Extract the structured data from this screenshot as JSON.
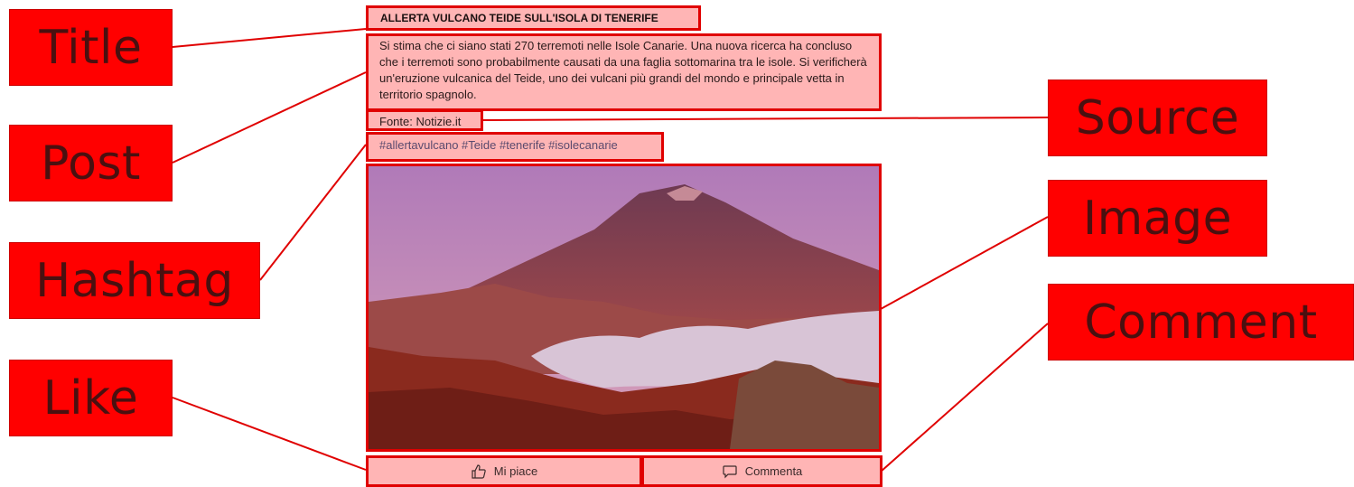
{
  "callouts": {
    "title": "Title",
    "post": "Post",
    "hashtag": "Hashtag",
    "like": "Like",
    "source": "Source",
    "image": "Image",
    "comment": "Comment"
  },
  "post": {
    "title": "ALLERTA VULCANO TEIDE SULL'ISOLA DI TENERIFE",
    "body": "Si stima che ci siano stati 270 terremoti nelle Isole Canarie. Una nuova ricerca ha concluso che i terremoti sono probabilmente causati da una faglia sottomarina tra le isole. Si verificherà un'eruzione vulcanica del Teide, uno dei vulcani più grandi del mondo e principale vetta in territorio spagnolo.",
    "source": "Fonte: Notizie.it",
    "hashtags": "#allertavulcano #Teide #tenerife #isolecanarie",
    "image_icon": "volcano-photo",
    "actions": {
      "like_label": "Mi piace",
      "like_icon": "thumbs-up-icon",
      "comment_label": "Commenta",
      "comment_icon": "speech-bubble-icon"
    }
  },
  "colors": {
    "callout_bg": "#ff0000",
    "highlight_border": "#e00000",
    "highlight_fill": "rgba(255,120,120,0.55)"
  }
}
